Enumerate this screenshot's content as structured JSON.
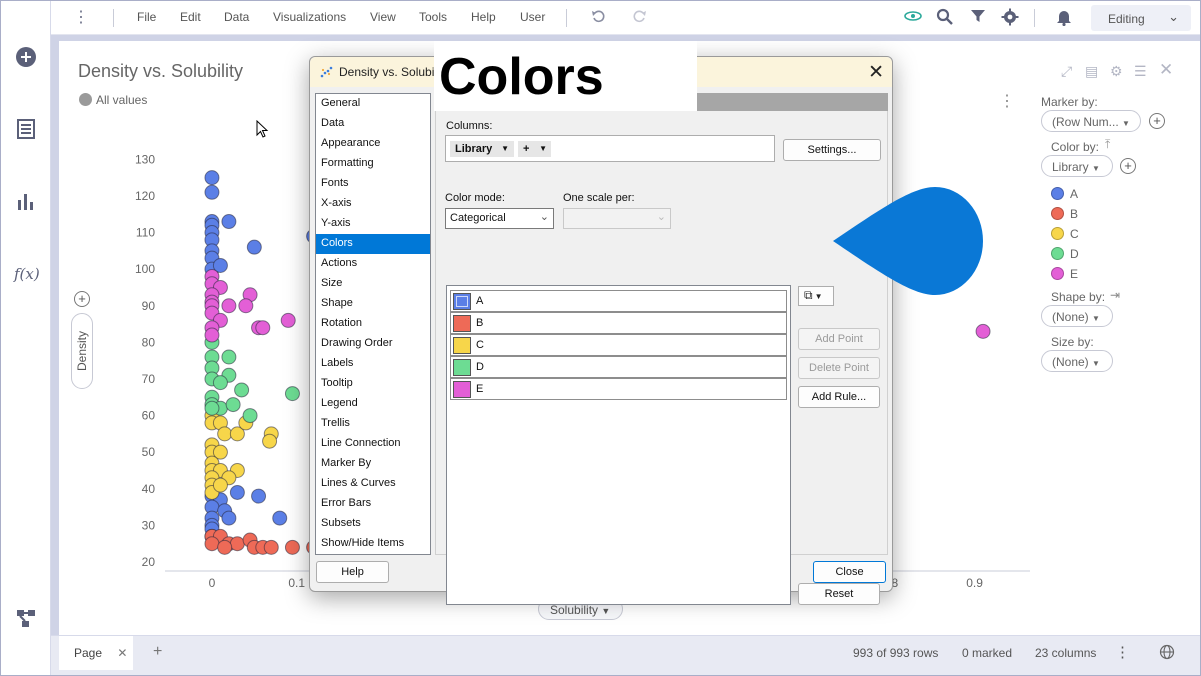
{
  "app": {
    "mode": "Editing"
  },
  "menu": [
    "File",
    "Edit",
    "Data",
    "Visualizations",
    "View",
    "Tools",
    "Help",
    "User"
  ],
  "visualization": {
    "title": "Density vs. Solubility",
    "all_values": "All values",
    "y_axis": "Density",
    "x_axis": "Solubility"
  },
  "right_panel": {
    "marker_by_label": "Marker by:",
    "marker_by_value": "(Row Num...",
    "color_by_label": "Color by:",
    "color_by_value": "Library",
    "legend": [
      {
        "name": "A",
        "color": "#5b7fe6"
      },
      {
        "name": "B",
        "color": "#ee6a57"
      },
      {
        "name": "C",
        "color": "#f7d64a"
      },
      {
        "name": "D",
        "color": "#6ddc93"
      },
      {
        "name": "E",
        "color": "#e35fd6"
      }
    ],
    "shape_by_label": "Shape by:",
    "shape_by_value": "(None)",
    "size_by_label": "Size by:",
    "size_by_value": "(None)"
  },
  "status": {
    "page_tab": "Page",
    "rows": "993 of 993 rows",
    "marked": "0 marked",
    "columns": "23 columns"
  },
  "banner": "Colors",
  "dialog": {
    "title": "Density vs. Solubi",
    "categories": [
      "General",
      "Data",
      "Appearance",
      "Formatting",
      "Fonts",
      "X-axis",
      "Y-axis",
      "Colors",
      "Actions",
      "Size",
      "Shape",
      "Rotation",
      "Drawing Order",
      "Labels",
      "Tooltip",
      "Legend",
      "Trellis",
      "Line Connection",
      "Marker By",
      "Lines & Curves",
      "Error Bars",
      "Subsets",
      "Show/Hide Items"
    ],
    "selected_category": "Colors",
    "columns_label": "Columns:",
    "column_token": "Library",
    "add_token": "+",
    "settings_button": "Settings...",
    "color_mode_label": "Color mode:",
    "color_mode_value": "Categorical",
    "one_scale_label": "One scale per:",
    "one_scale_value": "",
    "color_entries": [
      {
        "name": "A",
        "color": "#5b7fe6"
      },
      {
        "name": "B",
        "color": "#ee6a57"
      },
      {
        "name": "C",
        "color": "#f7d64a"
      },
      {
        "name": "D",
        "color": "#6ddc93"
      },
      {
        "name": "E",
        "color": "#e35fd6"
      }
    ],
    "add_point": "Add Point",
    "delete_point": "Delete Point",
    "add_rule": "Add Rule...",
    "reset": "Reset",
    "help": "Help",
    "close": "Close"
  },
  "chart_data": {
    "type": "scatter",
    "title": "Density vs. Solubility",
    "xlabel": "Solubility",
    "ylabel": "Density",
    "xlim": [
      -0.02,
      0.93
    ],
    "ylim": [
      20,
      132
    ],
    "x_ticks": [
      "0",
      "0.1",
      "0.8",
      "0.9"
    ],
    "y_ticks": [
      "20",
      "30",
      "40",
      "50",
      "60",
      "70",
      "80",
      "90",
      "100",
      "110",
      "120",
      "130"
    ],
    "grid": false,
    "series": [
      {
        "name": "A",
        "color": "#5b7fe6",
        "points": [
          [
            0,
            125
          ],
          [
            0,
            121
          ],
          [
            0,
            113
          ],
          [
            0.02,
            113
          ],
          [
            0,
            112
          ],
          [
            0,
            110
          ],
          [
            0,
            108
          ],
          [
            0,
            105
          ],
          [
            0,
            103
          ],
          [
            0,
            100
          ],
          [
            0.01,
            101
          ],
          [
            0.05,
            106
          ],
          [
            0.12,
            109
          ],
          [
            0,
            38
          ],
          [
            0.01,
            37
          ],
          [
            0.03,
            39
          ],
          [
            0.055,
            38
          ],
          [
            0,
            35
          ],
          [
            0.015,
            34
          ],
          [
            0,
            32
          ],
          [
            0.02,
            32
          ],
          [
            0.08,
            32
          ],
          [
            0,
            30
          ],
          [
            0,
            29
          ],
          [
            0,
            27
          ]
        ]
      },
      {
        "name": "B",
        "color": "#ee6a57",
        "points": [
          [
            0,
            27
          ],
          [
            0.01,
            27
          ],
          [
            0.02,
            25
          ],
          [
            0.03,
            25
          ],
          [
            0.045,
            26
          ],
          [
            0,
            25
          ],
          [
            0.05,
            24
          ],
          [
            0.06,
            24
          ],
          [
            0.07,
            24
          ],
          [
            0.095,
            24
          ],
          [
            0.12,
            24
          ],
          [
            0.015,
            24
          ]
        ]
      },
      {
        "name": "C",
        "color": "#f7d64a",
        "points": [
          [
            0,
            60
          ],
          [
            0,
            58
          ],
          [
            0.01,
            58
          ],
          [
            0.015,
            55
          ],
          [
            0.03,
            55
          ],
          [
            0.04,
            58
          ],
          [
            0.07,
            55
          ],
          [
            0.068,
            53
          ],
          [
            0,
            52
          ],
          [
            0,
            50
          ],
          [
            0.01,
            50
          ],
          [
            0,
            47
          ],
          [
            0,
            45
          ],
          [
            0.01,
            45
          ],
          [
            0.03,
            45
          ],
          [
            0,
            43
          ],
          [
            0.02,
            43
          ],
          [
            0,
            41
          ],
          [
            0,
            39
          ],
          [
            0.01,
            41
          ]
        ]
      },
      {
        "name": "D",
        "color": "#6ddc93",
        "points": [
          [
            0,
            80
          ],
          [
            0,
            76
          ],
          [
            0.02,
            76
          ],
          [
            0,
            73
          ],
          [
            0.02,
            71
          ],
          [
            0,
            70
          ],
          [
            0.01,
            69
          ],
          [
            0.035,
            67
          ],
          [
            0.095,
            66
          ],
          [
            0,
            65
          ],
          [
            0,
            63
          ],
          [
            0.01,
            62
          ],
          [
            0.025,
            63
          ],
          [
            0.045,
            60
          ],
          [
            0,
            62
          ]
        ]
      },
      {
        "name": "E",
        "color": "#e35fd6",
        "points": [
          [
            0,
            98
          ],
          [
            0,
            96
          ],
          [
            0.01,
            95
          ],
          [
            0,
            93
          ],
          [
            0.045,
            93
          ],
          [
            0,
            91
          ],
          [
            0,
            90
          ],
          [
            0.02,
            90
          ],
          [
            0.04,
            90
          ],
          [
            0,
            88
          ],
          [
            0.01,
            86
          ],
          [
            0.09,
            86
          ],
          [
            0,
            84
          ],
          [
            0.055,
            84
          ],
          [
            0.06,
            84
          ],
          [
            0,
            82
          ],
          [
            0.91,
            83
          ]
        ]
      }
    ]
  }
}
